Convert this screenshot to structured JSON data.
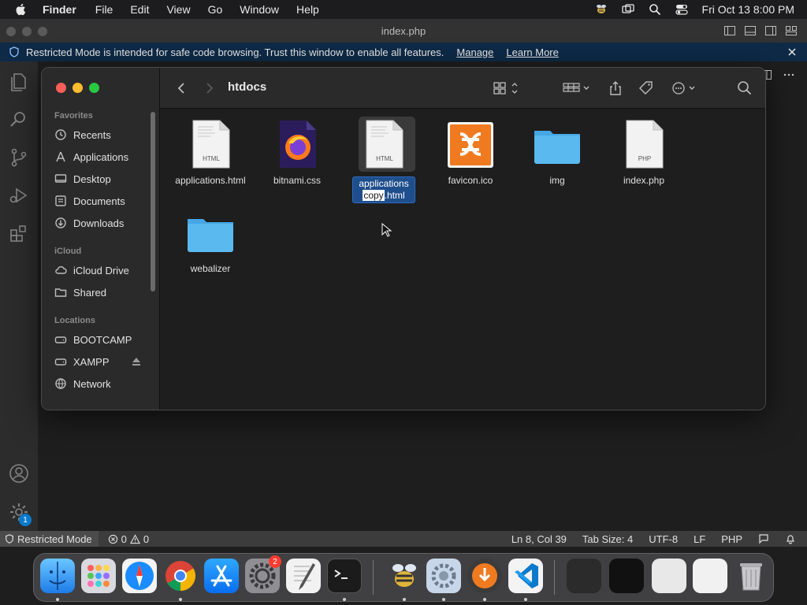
{
  "menubar": {
    "app_name": "Finder",
    "items": [
      "File",
      "Edit",
      "View",
      "Go",
      "Window",
      "Help"
    ],
    "clock": "Fri Oct 13  8:00 PM",
    "icons": [
      "bee-icon",
      "screen-mirror-icon",
      "search-icon",
      "control-center-icon"
    ]
  },
  "titlebar": {
    "title": "index.php"
  },
  "banner": {
    "message": "Restricted Mode is intended for safe code browsing. Trust this window to enable all features.",
    "manage_label": "Manage",
    "learn_label": "Learn More"
  },
  "statusbar": {
    "restricted": "Restricted Mode",
    "errors": "0",
    "warnings": "0",
    "position": "Ln 8, Col 39",
    "tab_size": "Tab Size: 4",
    "encoding": "UTF-8",
    "eol": "LF",
    "language": "PHP"
  },
  "activity": {
    "badge": "1"
  },
  "finder": {
    "path_title": "htdocs",
    "sections": {
      "favorites": "Favorites",
      "icloud": "iCloud",
      "locations": "Locations"
    },
    "favorites": [
      "Recents",
      "Applications",
      "Desktop",
      "Documents",
      "Downloads"
    ],
    "icloud": [
      "iCloud Drive",
      "Shared"
    ],
    "locations": [
      "BOOTCAMP",
      "XAMPP",
      "Network"
    ],
    "files": [
      {
        "name": "applications.html",
        "type": "html"
      },
      {
        "name": "bitnami.css",
        "type": "css"
      },
      {
        "name_line1": "applications",
        "name_line2_sel": "copy",
        "name_line2_rest": ".html",
        "type": "html"
      },
      {
        "name": "favicon.ico",
        "type": "ico"
      },
      {
        "name": "img",
        "type": "folder"
      },
      {
        "name": "index.php",
        "type": "php"
      },
      {
        "name": "webalizer",
        "type": "folder"
      }
    ],
    "icon_labels": {
      "html": "HTML",
      "php": "PHP"
    }
  },
  "colors": {
    "banner_bg": "#0e2a47",
    "status_bg": "#3c3c3c",
    "accent": "#0a7acc",
    "folder": "#5ab9ef",
    "selection": "#1f4e8c"
  }
}
